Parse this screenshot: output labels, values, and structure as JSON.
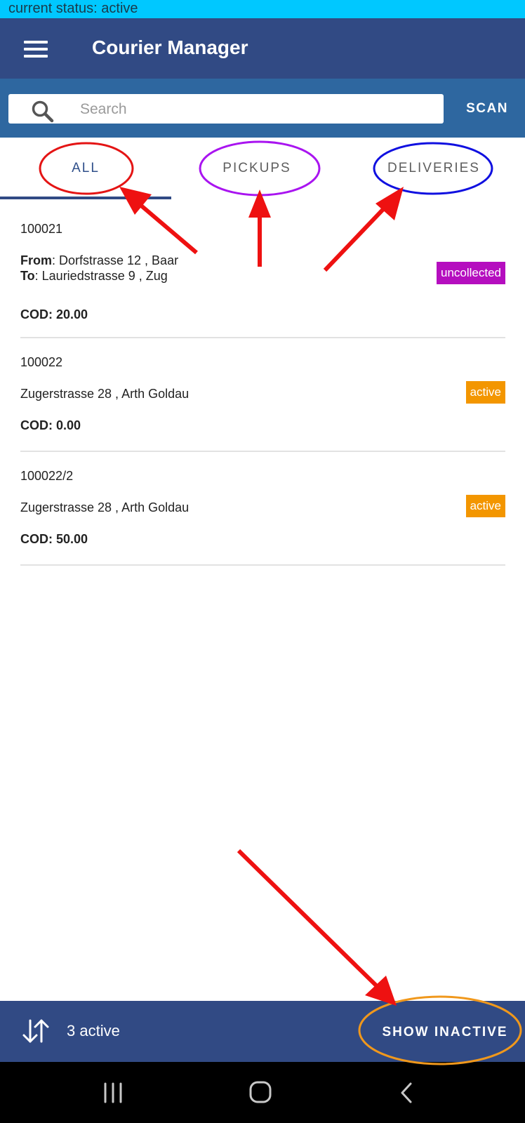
{
  "status_strip": {
    "text": "current status: active"
  },
  "appbar": {
    "title": "Courier Manager",
    "menu_icon": "menu-icon"
  },
  "search": {
    "placeholder": "Search",
    "value": "",
    "scan_label": "SCAN"
  },
  "tabs": [
    {
      "label": "ALL",
      "selected": true
    },
    {
      "label": "PICKUPS",
      "selected": false
    },
    {
      "label": "DELIVERIES",
      "selected": false
    }
  ],
  "items": [
    {
      "id": "100021",
      "from_label": "From",
      "from": ": Dorfstrasse 12 , Baar",
      "to_label": "To",
      "to": ": Lauriedstrasse 9 , Zug",
      "cod": "COD: 20.00",
      "badge": "uncollected",
      "badge_color": "#b50ebf"
    },
    {
      "id": "100022",
      "address": "Zugerstrasse 28 , Arth Goldau",
      "cod": "COD: 0.00",
      "badge": "active",
      "badge_color": "#f39600"
    },
    {
      "id": "100022/2",
      "address": "Zugerstrasse 28 , Arth Goldau",
      "cod": "COD: 50.00",
      "badge": "active",
      "badge_color": "#f39600"
    }
  ],
  "bottombar": {
    "count_label": "3 active",
    "show_inactive_label": "SHOW INACTIVE",
    "sort_icon": "sort-icon"
  },
  "annotations": {
    "arrow_color": "#ee1111",
    "highlight_colors": [
      "#e41414",
      "#a914f0",
      "#1010e0",
      "#f0981c"
    ]
  },
  "colors": {
    "appbar": "#314a84",
    "searchbar": "#2e67a0",
    "status_strip": "#00c8ff"
  }
}
